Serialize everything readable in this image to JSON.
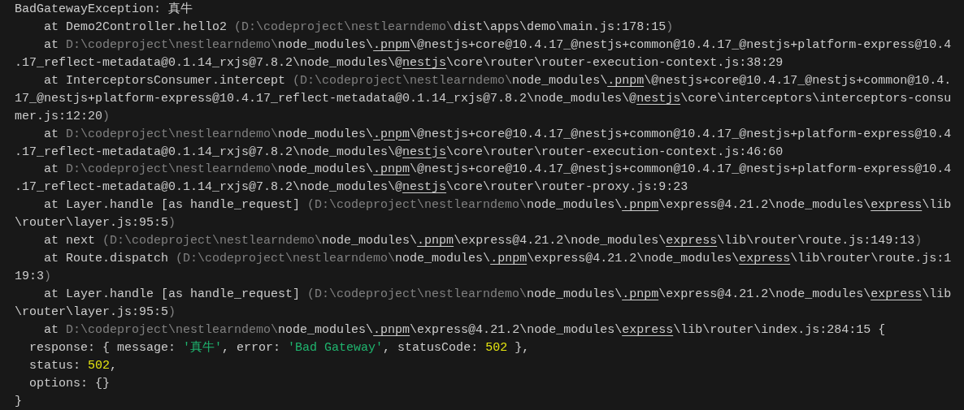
{
  "terminal": {
    "lines": [
      {
        "segments": [
          {
            "kind": "plain",
            "text": "BadGatewayException: 真牛"
          }
        ]
      },
      {
        "segments": [
          {
            "kind": "plain",
            "text": "    at Demo2Controller.hello2 "
          },
          {
            "kind": "dim",
            "text": "(D:\\codeproject\\nestlearndemo\\"
          },
          {
            "kind": "plain",
            "text": "dist\\apps\\demo\\main.js:178:15"
          },
          {
            "kind": "dim",
            "text": ")"
          }
        ]
      },
      {
        "segments": [
          {
            "kind": "plain",
            "text": "    at "
          },
          {
            "kind": "dim",
            "text": "D:\\codeproject\\nestlearndemo\\"
          },
          {
            "kind": "plain",
            "text": "node_modules\\"
          },
          {
            "kind": "link",
            "text": ".pnpm"
          },
          {
            "kind": "plain",
            "text": "\\@nestjs+core@10.4.17_@nestjs+common@10.4.17_@nestjs+platform-express@10.4"
          }
        ]
      },
      {
        "segments": [
          {
            "kind": "plain",
            "text": ".17_reflect-metadata@0.1.14_rxjs@7.8.2\\node_modules\\@"
          },
          {
            "kind": "link",
            "text": "nestjs"
          },
          {
            "kind": "plain",
            "text": "\\core\\router\\router-execution-context.js:38:29"
          }
        ]
      },
      {
        "segments": [
          {
            "kind": "plain",
            "text": "    at InterceptorsConsumer.intercept "
          },
          {
            "kind": "dim",
            "text": "(D:\\codeproject\\nestlearndemo\\"
          },
          {
            "kind": "plain",
            "text": "node_modules\\"
          },
          {
            "kind": "link",
            "text": ".pnpm"
          },
          {
            "kind": "plain",
            "text": "\\@nestjs+core@10.4.17_@nestjs+common@10.4."
          }
        ]
      },
      {
        "segments": [
          {
            "kind": "plain",
            "text": "17_@nestjs+platform-express@10.4.17_reflect-metadata@0.1.14_rxjs@7.8.2\\node_modules\\@"
          },
          {
            "kind": "link",
            "text": "nestjs"
          },
          {
            "kind": "plain",
            "text": "\\core\\interceptors\\interceptors-consu"
          }
        ]
      },
      {
        "segments": [
          {
            "kind": "plain",
            "text": "mer.js:12:20"
          },
          {
            "kind": "dim",
            "text": ")"
          }
        ]
      },
      {
        "segments": [
          {
            "kind": "plain",
            "text": "    at "
          },
          {
            "kind": "dim",
            "text": "D:\\codeproject\\nestlearndemo\\"
          },
          {
            "kind": "plain",
            "text": "node_modules\\"
          },
          {
            "kind": "link",
            "text": ".pnpm"
          },
          {
            "kind": "plain",
            "text": "\\@nestjs+core@10.4.17_@nestjs+common@10.4.17_@nestjs+platform-express@10.4"
          }
        ]
      },
      {
        "segments": [
          {
            "kind": "plain",
            "text": ".17_reflect-metadata@0.1.14_rxjs@7.8.2\\node_modules\\@"
          },
          {
            "kind": "link",
            "text": "nestjs"
          },
          {
            "kind": "plain",
            "text": "\\core\\router\\router-execution-context.js:46:60"
          }
        ]
      },
      {
        "segments": [
          {
            "kind": "plain",
            "text": "    at "
          },
          {
            "kind": "dim",
            "text": "D:\\codeproject\\nestlearndemo\\"
          },
          {
            "kind": "plain",
            "text": "node_modules\\"
          },
          {
            "kind": "link",
            "text": ".pnpm"
          },
          {
            "kind": "plain",
            "text": "\\@nestjs+core@10.4.17_@nestjs+common@10.4.17_@nestjs+platform-express@10.4"
          }
        ]
      },
      {
        "segments": [
          {
            "kind": "plain",
            "text": ".17_reflect-metadata@0.1.14_rxjs@7.8.2\\node_modules\\@"
          },
          {
            "kind": "link",
            "text": "nestjs"
          },
          {
            "kind": "plain",
            "text": "\\core\\router\\router-proxy.js:9:23"
          }
        ]
      },
      {
        "segments": [
          {
            "kind": "plain",
            "text": "    at Layer.handle [as handle_request] "
          },
          {
            "kind": "dim",
            "text": "(D:\\codeproject\\nestlearndemo\\"
          },
          {
            "kind": "plain",
            "text": "node_modules\\"
          },
          {
            "kind": "link",
            "text": ".pnpm"
          },
          {
            "kind": "plain",
            "text": "\\express@4.21.2\\node_modules\\"
          },
          {
            "kind": "link",
            "text": "express"
          },
          {
            "kind": "plain",
            "text": "\\lib"
          }
        ]
      },
      {
        "segments": [
          {
            "kind": "plain",
            "text": "\\router\\layer.js:95:5"
          },
          {
            "kind": "dim",
            "text": ")"
          }
        ]
      },
      {
        "segments": [
          {
            "kind": "plain",
            "text": "    at next "
          },
          {
            "kind": "dim",
            "text": "(D:\\codeproject\\nestlearndemo\\"
          },
          {
            "kind": "plain",
            "text": "node_modules\\"
          },
          {
            "kind": "link",
            "text": ".pnpm"
          },
          {
            "kind": "plain",
            "text": "\\express@4.21.2\\node_modules\\"
          },
          {
            "kind": "link",
            "text": "express"
          },
          {
            "kind": "plain",
            "text": "\\lib\\router\\route.js:149:13"
          },
          {
            "kind": "dim",
            "text": ")"
          }
        ]
      },
      {
        "segments": [
          {
            "kind": "plain",
            "text": "    at Route.dispatch "
          },
          {
            "kind": "dim",
            "text": "(D:\\codeproject\\nestlearndemo\\"
          },
          {
            "kind": "plain",
            "text": "node_modules\\"
          },
          {
            "kind": "link",
            "text": ".pnpm"
          },
          {
            "kind": "plain",
            "text": "\\express@4.21.2\\node_modules\\"
          },
          {
            "kind": "link",
            "text": "express"
          },
          {
            "kind": "plain",
            "text": "\\lib\\router\\route.js:1"
          }
        ]
      },
      {
        "segments": [
          {
            "kind": "plain",
            "text": "19:3"
          },
          {
            "kind": "dim",
            "text": ")"
          }
        ]
      },
      {
        "segments": [
          {
            "kind": "plain",
            "text": "    at Layer.handle [as handle_request] "
          },
          {
            "kind": "dim",
            "text": "(D:\\codeproject\\nestlearndemo\\"
          },
          {
            "kind": "plain",
            "text": "node_modules\\"
          },
          {
            "kind": "link",
            "text": ".pnpm"
          },
          {
            "kind": "plain",
            "text": "\\express@4.21.2\\node_modules\\"
          },
          {
            "kind": "link",
            "text": "express"
          },
          {
            "kind": "plain",
            "text": "\\lib"
          }
        ]
      },
      {
        "segments": [
          {
            "kind": "plain",
            "text": "\\router\\layer.js:95:5"
          },
          {
            "kind": "dim",
            "text": ")"
          }
        ]
      },
      {
        "segments": [
          {
            "kind": "plain",
            "text": "    at "
          },
          {
            "kind": "dim",
            "text": "D:\\codeproject\\nestlearndemo\\"
          },
          {
            "kind": "plain",
            "text": "node_modules\\"
          },
          {
            "kind": "link",
            "text": ".pnpm"
          },
          {
            "kind": "plain",
            "text": "\\express@4.21.2\\node_modules\\"
          },
          {
            "kind": "link",
            "text": "express"
          },
          {
            "kind": "plain",
            "text": "\\lib\\router\\index.js:284:15 {"
          }
        ]
      },
      {
        "segments": [
          {
            "kind": "plain",
            "text": "  response: { message: "
          },
          {
            "kind": "string",
            "text": "'真牛'"
          },
          {
            "kind": "plain",
            "text": ", error: "
          },
          {
            "kind": "string",
            "text": "'Bad Gateway'"
          },
          {
            "kind": "plain",
            "text": ", statusCode: "
          },
          {
            "kind": "number",
            "text": "502"
          },
          {
            "kind": "plain",
            "text": " },"
          }
        ]
      },
      {
        "segments": [
          {
            "kind": "plain",
            "text": "  status: "
          },
          {
            "kind": "number",
            "text": "502"
          },
          {
            "kind": "plain",
            "text": ","
          }
        ]
      },
      {
        "segments": [
          {
            "kind": "plain",
            "text": "  options: {}"
          }
        ]
      },
      {
        "segments": [
          {
            "kind": "plain",
            "text": "}"
          }
        ]
      }
    ]
  }
}
